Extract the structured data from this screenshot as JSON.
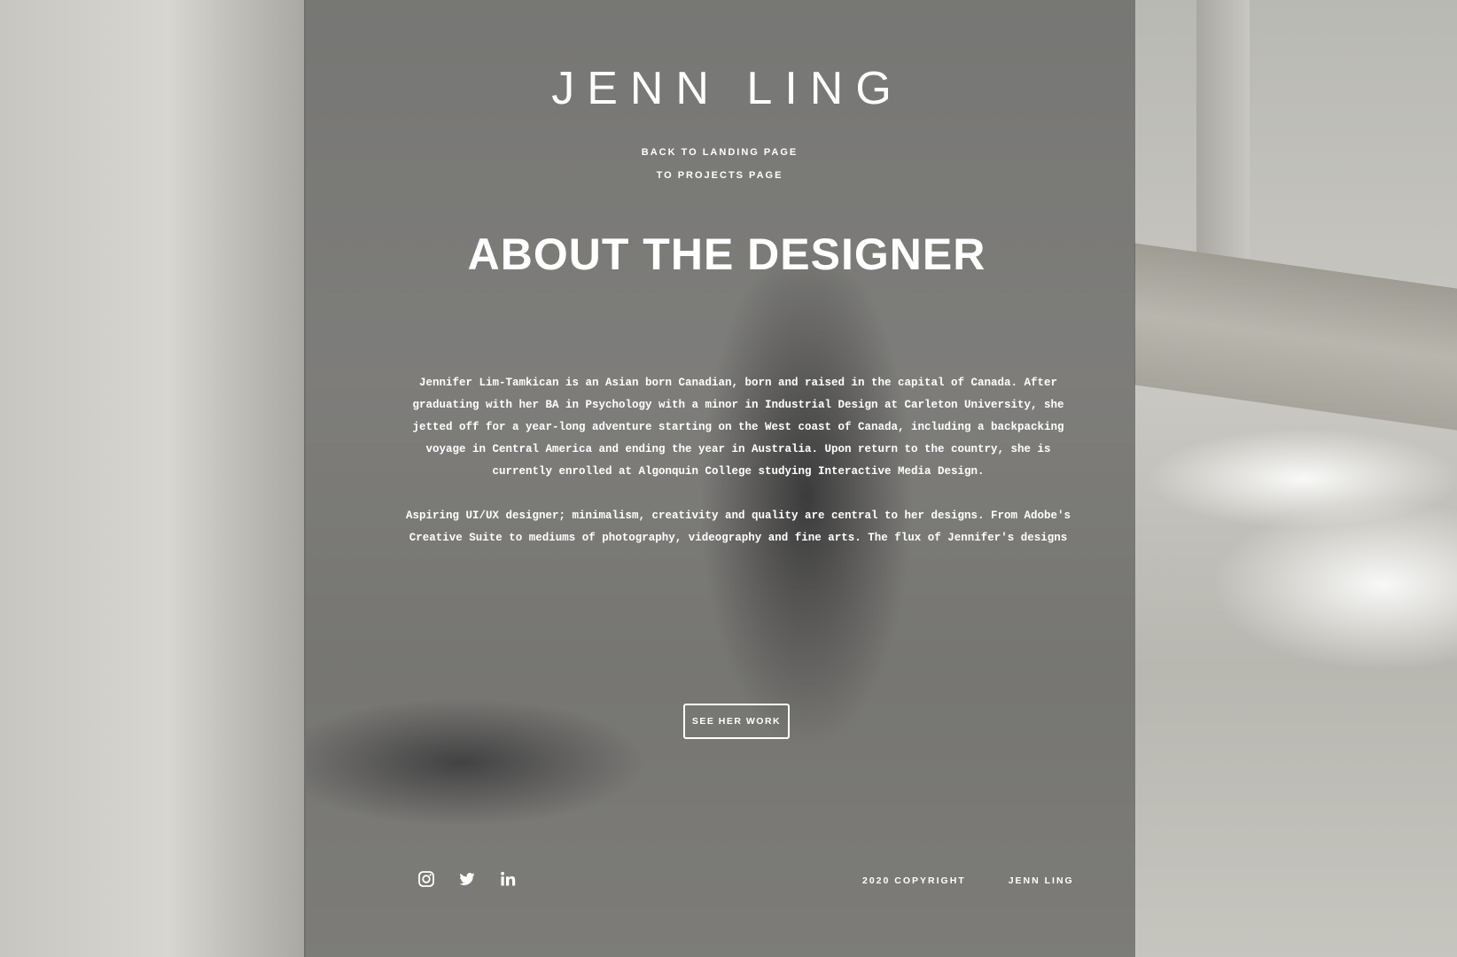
{
  "site": {
    "title": "JENN LING"
  },
  "nav": {
    "items": [
      {
        "label": "BACK TO LANDING PAGE"
      },
      {
        "label": "TO PROJECTS PAGE"
      }
    ]
  },
  "main": {
    "heading": "ABOUT THE DESIGNER",
    "paragraphs": [
      "Jennifer Lim-Tamkican is an Asian born Canadian, born and raised in the capital of Canada. After graduating with her BA in Psychology with a minor in Industrial Design at Carleton University, she jetted off for a year-long adventure starting on the West coast of Canada, including a backpacking voyage in Central America and ending the year in Australia. Upon return to the country, she is currently enrolled at Algonquin College studying Interactive Media Design.",
      "Aspiring UI/UX designer; minimalism, creativity and quality are central to her designs. From Adobe's Creative Suite to mediums of photography, videography and fine arts. The flux of Jennifer's designs for"
    ],
    "cta_label": "SEE HER WORK"
  },
  "footer": {
    "social_icons": [
      "instagram-icon",
      "twitter-icon",
      "linkedin-icon"
    ],
    "copyright": "2020 COPYRIGHT",
    "name": "JENN LING"
  },
  "colors": {
    "text": "#ffffff",
    "panel_overlay": "#464646"
  }
}
